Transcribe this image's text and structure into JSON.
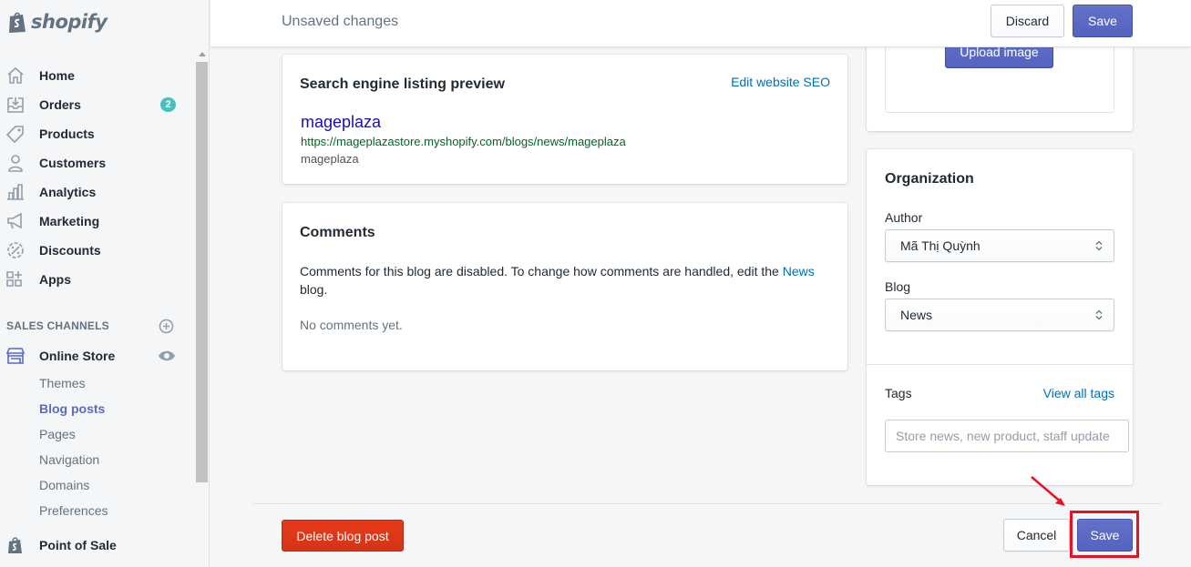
{
  "brand": {
    "name": "shopify"
  },
  "sidebar": {
    "nav": [
      {
        "label": "Home",
        "icon": "home-icon"
      },
      {
        "label": "Orders",
        "icon": "orders-icon",
        "badge": "2"
      },
      {
        "label": "Products",
        "icon": "tag-icon"
      },
      {
        "label": "Customers",
        "icon": "person-icon"
      },
      {
        "label": "Analytics",
        "icon": "bar-chart-icon"
      },
      {
        "label": "Marketing",
        "icon": "megaphone-icon"
      },
      {
        "label": "Discounts",
        "icon": "discount-icon"
      },
      {
        "label": "Apps",
        "icon": "apps-icon"
      }
    ],
    "sales_channels_title": "SALES CHANNELS",
    "online_store": {
      "label": "Online Store"
    },
    "online_store_items": [
      {
        "label": "Themes",
        "active": false
      },
      {
        "label": "Blog posts",
        "active": true
      },
      {
        "label": "Pages",
        "active": false
      },
      {
        "label": "Navigation",
        "active": false
      },
      {
        "label": "Domains",
        "active": false
      },
      {
        "label": "Preferences",
        "active": false
      }
    ],
    "point_of_sale": {
      "label": "Point of Sale"
    }
  },
  "topbar": {
    "title": "Unsaved changes",
    "discard_label": "Discard",
    "save_label": "Save"
  },
  "seo": {
    "title": "Search engine listing preview",
    "edit_link": "Edit website SEO",
    "preview_title": "mageplaza",
    "preview_url": "https://mageplazastore.myshopify.com/blogs/news/mageplaza",
    "preview_description": "mageplaza"
  },
  "comments": {
    "title": "Comments",
    "text_before": "Comments for this blog are disabled. To change how comments are handled, edit the ",
    "link": "News",
    "text_after": " blog.",
    "empty": "No comments yet."
  },
  "image": {
    "upload_label": "Upload image"
  },
  "organization": {
    "title": "Organization",
    "author_label": "Author",
    "author_value": "Mã Thị Quỳnh",
    "blog_label": "Blog",
    "blog_value": "News",
    "tags_label": "Tags",
    "view_all_tags": "View all tags",
    "tags_placeholder": "Store news, new product, staff update"
  },
  "footer": {
    "delete_label": "Delete blog post",
    "cancel_label": "Cancel",
    "save_label": "Save"
  },
  "colors": {
    "primary": "#5c6ac4",
    "danger": "#de3618",
    "link": "#006fbb",
    "badge": "#47c1bf",
    "annotation": "#e81123"
  }
}
